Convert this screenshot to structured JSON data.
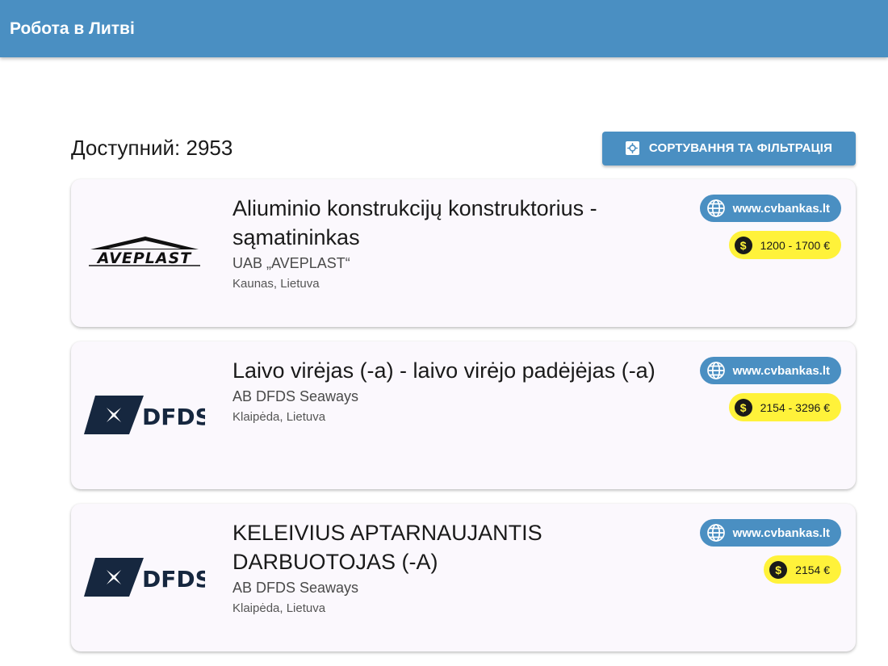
{
  "app": {
    "title": "Робота в Литві"
  },
  "toolbar": {
    "available_label": "Доступний: 2953",
    "filter_button_label": "СОРТУВАННЯ ТА ФІЛЬТРАЦІЯ"
  },
  "colors": {
    "primary": "#4a8fc2",
    "salary_badge": "#fff23a",
    "card_bg": "#fbf8fd"
  },
  "jobs": [
    {
      "title": "Aliuminio konstrukcijų konstruktorius - sąmatininkas",
      "company": "UAB „AVEPLAST“",
      "location": "Kaunas, Lietuva",
      "source": "www.cvbankas.lt",
      "salary": "1200 - 1700 €",
      "logo_text": "AVEPLAST"
    },
    {
      "title": "Laivo virėjas (-a) - laivo virėjo padėjėjas (-a)",
      "company": "AB DFDS Seaways",
      "location": "Klaipėda, Lietuva",
      "source": "www.cvbankas.lt",
      "salary": "2154 - 3296 €",
      "logo_text": "DFDS"
    },
    {
      "title": "KELEIVIUS APTARNAUJANTIS DARBUOTOJAS (-A)",
      "company": "AB DFDS Seaways",
      "location": "Klaipėda, Lietuva",
      "source": "www.cvbankas.lt",
      "salary": "2154 €",
      "logo_text": "DFDS"
    }
  ]
}
